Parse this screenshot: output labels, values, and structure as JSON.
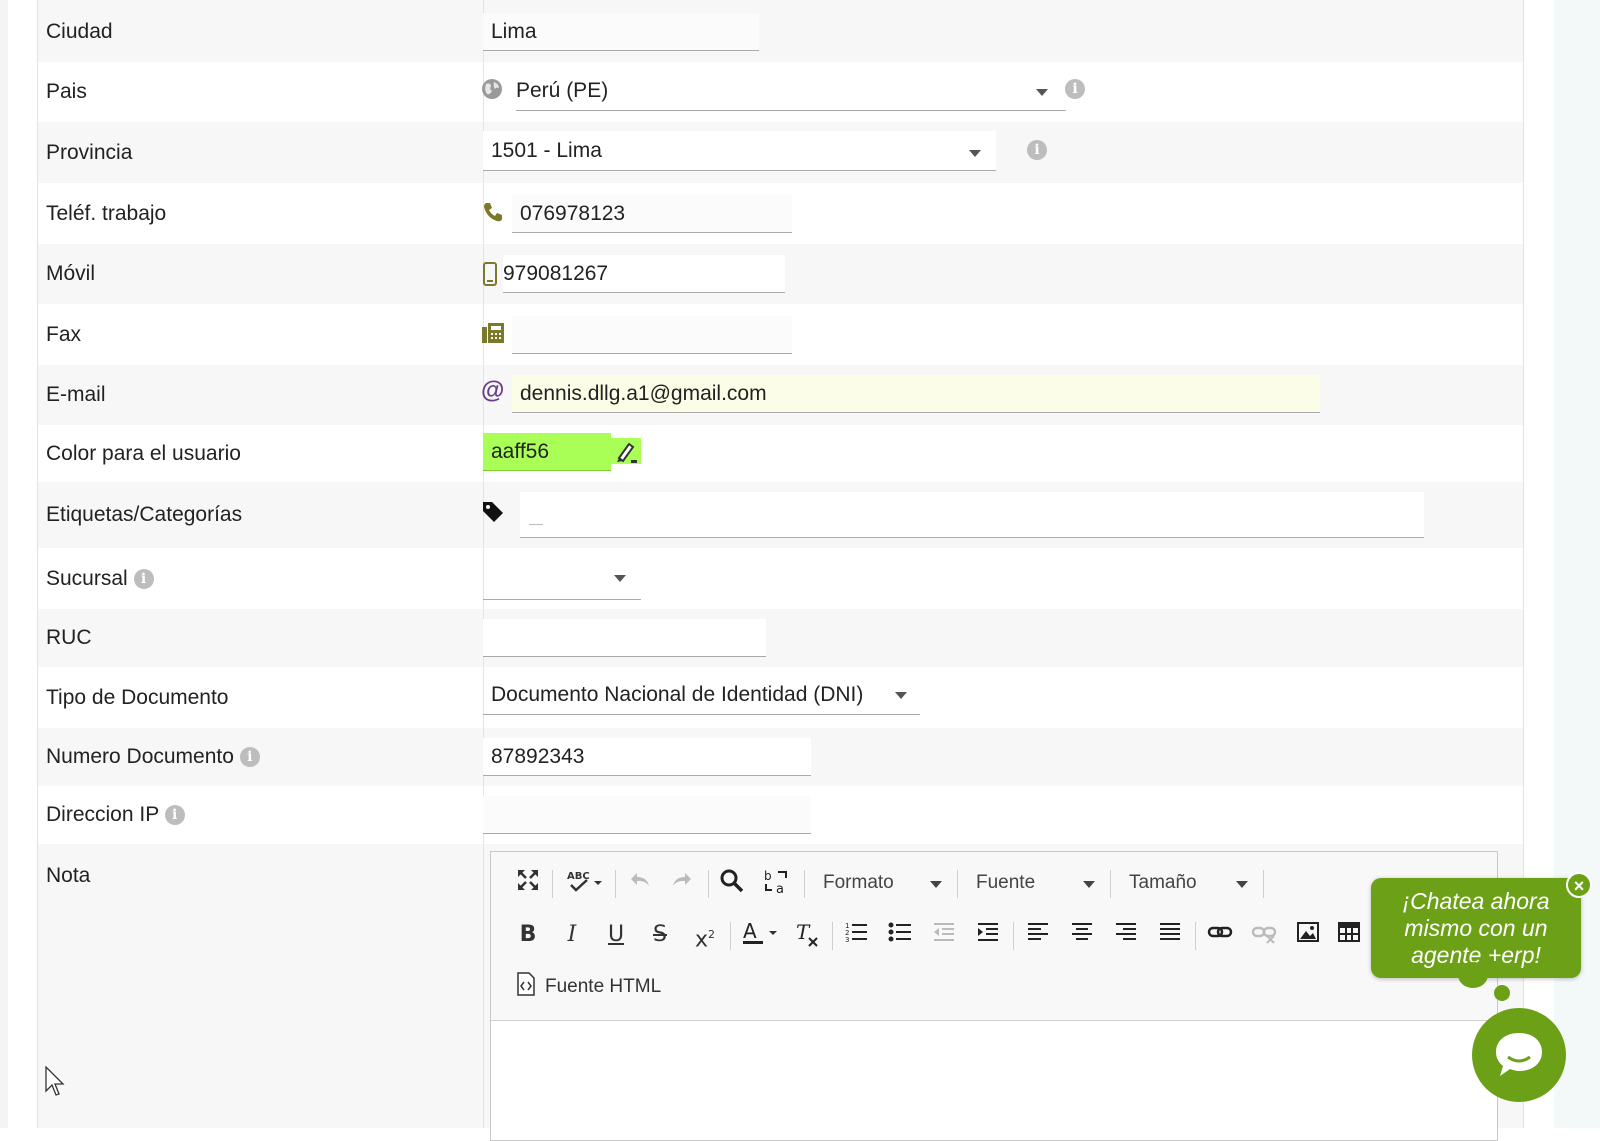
{
  "fields": {
    "ciudad": {
      "label": "Ciudad",
      "value": "Lima"
    },
    "pais": {
      "label": "Pais",
      "value": "Perú (PE)"
    },
    "provincia": {
      "label": "Provincia",
      "value": "1501 - Lima"
    },
    "telef_trabajo": {
      "label": "Teléf. trabajo",
      "value": "076978123"
    },
    "movil": {
      "label": "Móvil",
      "value": "979081267"
    },
    "fax": {
      "label": "Fax",
      "value": ""
    },
    "email": {
      "label": "E-mail",
      "value": "dennis.dllg.a1@gmail.com"
    },
    "color": {
      "label": "Color para el usuario",
      "value": "aaff56",
      "swatch": "#aaff56"
    },
    "etiquetas": {
      "label": "Etiquetas/Categorías",
      "value": ""
    },
    "sucursal": {
      "label": "Sucursal",
      "value": ""
    },
    "ruc": {
      "label": "RUC",
      "value": ""
    },
    "tipo_documento": {
      "label": "Tipo de Documento",
      "value": "Documento Nacional de Identidad (DNI)"
    },
    "numero_documento": {
      "label": "Numero Documento",
      "value": "87892343"
    },
    "direccion_ip": {
      "label": "Direccion IP",
      "value": ""
    },
    "nota": {
      "label": "Nota",
      "value": ""
    }
  },
  "editor": {
    "format_combo": "Formato",
    "font_combo": "Fuente",
    "size_combo": "Tamaño",
    "source_button": "Fuente HTML"
  },
  "chat": {
    "line1": "¡Chatea ahora",
    "line2": "mismo con un",
    "line3": "agente +erp!",
    "close": "×"
  },
  "colors": {
    "icon_olive": "#7a7a2a",
    "email_icon": "#6b3b8a",
    "chat_green": "#6ca117",
    "email_bg": "#fbfde6"
  }
}
